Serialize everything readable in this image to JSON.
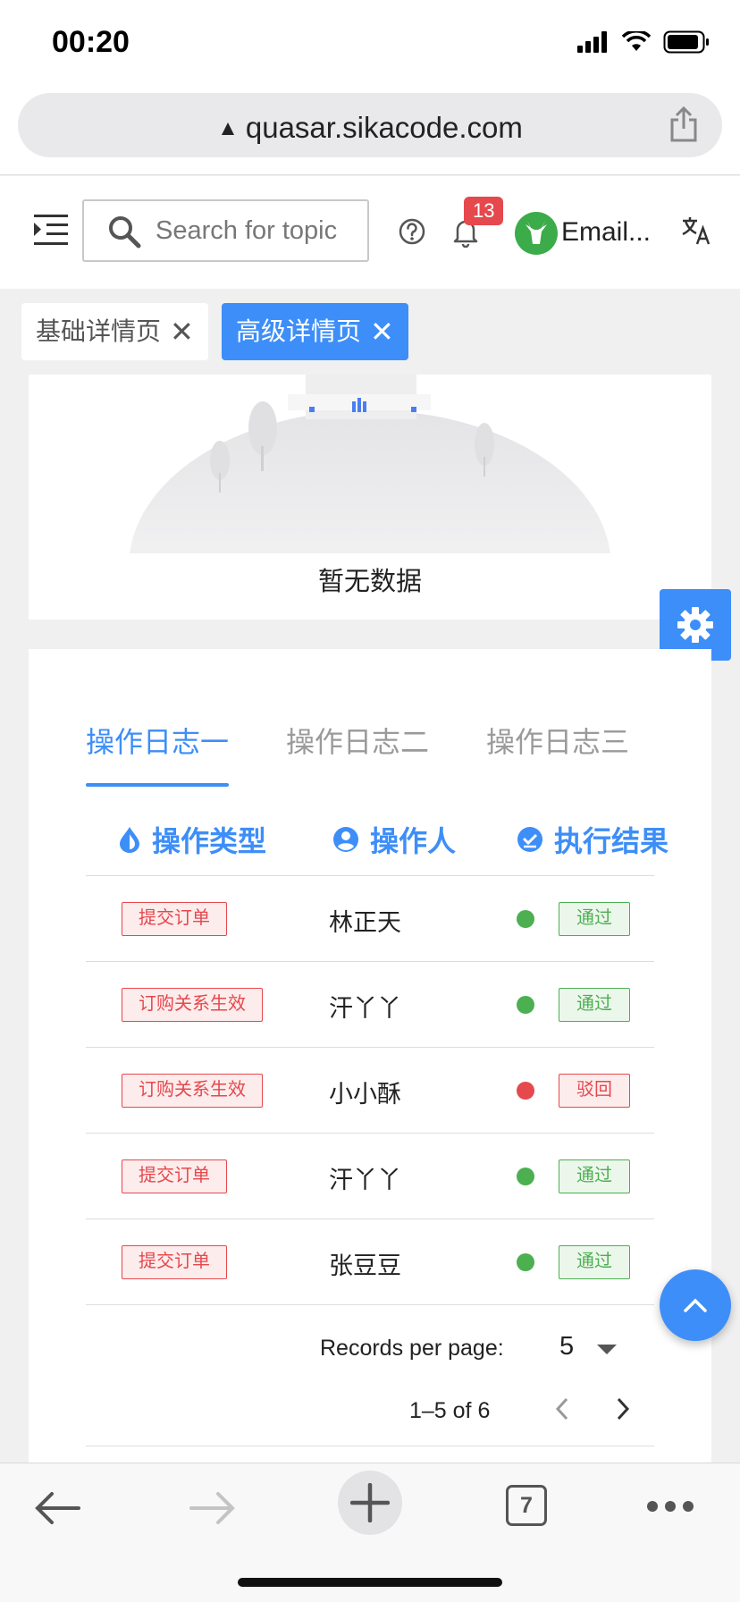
{
  "status_bar": {
    "time": "00:20"
  },
  "browser": {
    "url": "quasar.sikacode.com",
    "tab_count": "7"
  },
  "header": {
    "search_placeholder": "Search for topic",
    "notification_count": "13",
    "user_name": "Email..."
  },
  "tag_tabs": [
    {
      "label": "基础详情页",
      "active": false
    },
    {
      "label": "高级详情页",
      "active": true
    }
  ],
  "empty_state": {
    "text": "暂无数据"
  },
  "log_tabs": [
    {
      "label": "操作日志一",
      "active": true
    },
    {
      "label": "操作日志二",
      "active": false
    },
    {
      "label": "操作日志三",
      "active": false
    }
  ],
  "table": {
    "columns": [
      {
        "label": "操作类型",
        "icon": "drop-icon"
      },
      {
        "label": "操作人",
        "icon": "account-circle-icon"
      },
      {
        "label": "执行结果",
        "icon": "check-circle-icon"
      }
    ],
    "rows": [
      {
        "type": "提交订单",
        "person": "林正天",
        "result": "通过",
        "status": "pass"
      },
      {
        "type": "订购关系生效",
        "person": "汗丫丫",
        "result": "通过",
        "status": "pass"
      },
      {
        "type": "订购关系生效",
        "person": "小小酥",
        "result": "驳回",
        "status": "reject"
      },
      {
        "type": "提交订单",
        "person": "汗丫丫",
        "result": "通过",
        "status": "pass"
      },
      {
        "type": "提交订单",
        "person": "张豆豆",
        "result": "通过",
        "status": "pass"
      }
    ],
    "records_per_page_label": "Records per page:",
    "records_per_page": "5",
    "range_text": "1–5 of 6"
  },
  "colors": {
    "primary": "#3d8ef8",
    "pass": "#4caf50",
    "reject": "#e5484d"
  }
}
